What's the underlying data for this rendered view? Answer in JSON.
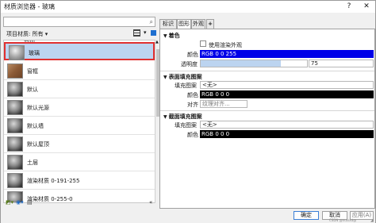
{
  "window": {
    "title": "材质浏览器 - 玻璃",
    "help_icon": "?",
    "close_icon": "✕"
  },
  "left_pane": {
    "search_placeholder": "",
    "filter_label": "项目材质: 所有 ▾",
    "list_header_partial": "名称",
    "items": [
      {
        "name": "玻璃",
        "thumb": "glass",
        "selected": true
      },
      {
        "name": "窗框",
        "thumb": "wood",
        "selected": false
      },
      {
        "name": "默认",
        "thumb": "sphere",
        "selected": false
      },
      {
        "name": "默认光源",
        "thumb": "sphere",
        "selected": false
      },
      {
        "name": "默认墙",
        "thumb": "sphere",
        "selected": false
      },
      {
        "name": "默认屋顶",
        "thumb": "sphere",
        "selected": false
      },
      {
        "name": "土层",
        "thumb": "sphere",
        "selected": false
      },
      {
        "name": "渲染材质 0-191-255",
        "thumb": "sphere",
        "selected": false
      },
      {
        "name": "渲染材质 0-255-0",
        "thumb": "sphere",
        "selected": false
      }
    ],
    "collapse_label": "«"
  },
  "right_pane": {
    "tabs": [
      {
        "label": "标识",
        "active": false
      },
      {
        "label": "图形",
        "active": true
      },
      {
        "label": "外观",
        "active": false
      },
      {
        "label": "+",
        "active": false
      }
    ],
    "shading": {
      "section_title": "着色",
      "use_render_label": "使用渲染外观",
      "color_label": "颜色",
      "color_value": "RGB 0 0 255",
      "color_hex": "#0000e8",
      "transparency_label": "透明度",
      "transparency_value": "75",
      "transparency_fraction": 0.75
    },
    "surface_pattern": {
      "section_title": "表面填充图案",
      "pattern_label": "填充图案",
      "pattern_value": "<无>",
      "color_label": "颜色",
      "color_value": "RGB 0 0 0",
      "align_label": "对齐",
      "align_value": "纹理对齐..."
    },
    "cut_pattern": {
      "section_title": "截面填充图案",
      "pattern_label": "填充图案",
      "pattern_value": "<无>",
      "color_label": "颜色",
      "color_value": "RGB 0 0 0"
    }
  },
  "buttons": {
    "ok": "确定",
    "cancel": "取消",
    "apply": "应用(A)"
  },
  "watermark": "CSDN @nutsxd@"
}
